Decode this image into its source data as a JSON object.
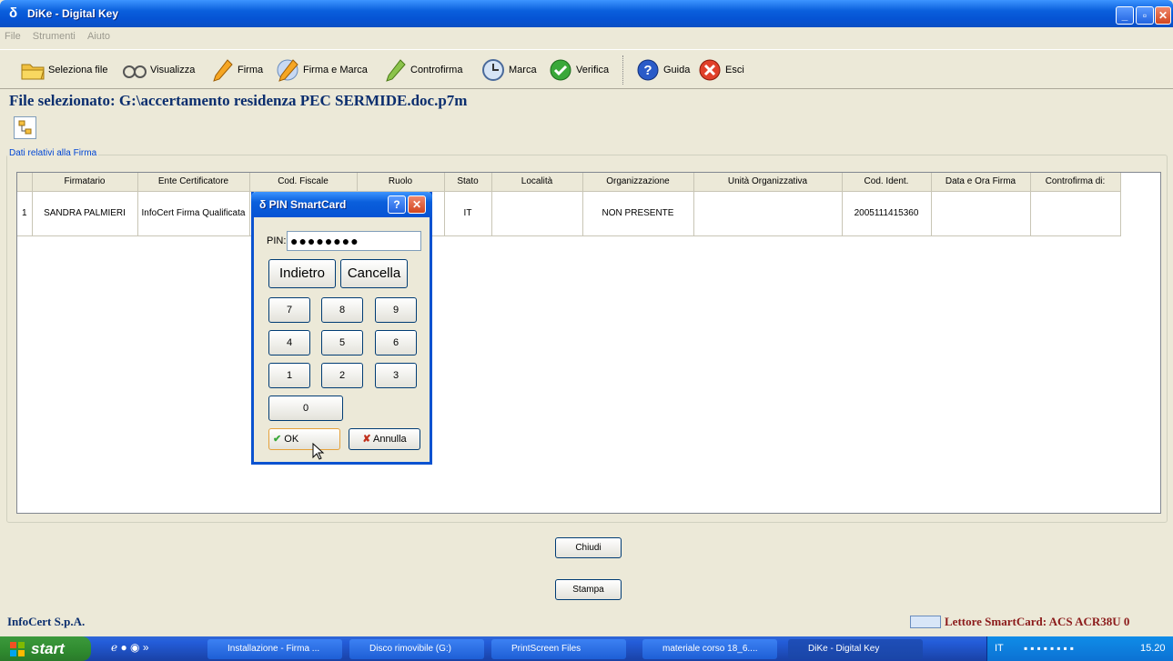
{
  "window": {
    "title": "DiKe - Digital Key",
    "icon": "delta-icon"
  },
  "menu": [
    "File",
    "Strumenti",
    "Aiuto"
  ],
  "toolbar": {
    "items": [
      "Seleziona file",
      "Visualizza",
      "Firma",
      "Firma e Marca",
      "Controfirma",
      "Marca",
      "Verifica",
      "Guida",
      "Esci"
    ]
  },
  "file_selected": "File selezionato: G:\\accertamento residenza PEC SERMIDE.doc.p7m",
  "group_title": "Dati relativi alla Firma",
  "table": {
    "headers": [
      "Firmatario",
      "Ente Certificatore",
      "Cod. Fiscale",
      "Ruolo",
      "Stato",
      "Località",
      "Organizzazione",
      "Unità Organizzativa",
      "Cod. Ident.",
      "Data e Ora Firma",
      "Controfirma di:"
    ],
    "rows": [
      {
        "index": "1",
        "cells": [
          "SANDRA PALMIERI",
          "InfoCert Firma Qualificata",
          "",
          "",
          "IT",
          "",
          "NON PRESENTE",
          "",
          "2005111415360",
          "",
          ""
        ]
      }
    ]
  },
  "buttons": {
    "close": "Chiudi",
    "print": "Stampa"
  },
  "footer": {
    "left": "InfoCert S.p.A.",
    "right": "Lettore SmartCard: ACS ACR38U 0"
  },
  "dialog": {
    "title": "PIN SmartCard",
    "pin_label": "PIN:",
    "pin_value": "●●●●●●●●",
    "back": "Indietro",
    "clear": "Cancella",
    "keys": [
      "7",
      "8",
      "9",
      "4",
      "5",
      "6",
      "1",
      "2",
      "3",
      "0"
    ],
    "ok": "OK",
    "cancel": "Annulla"
  },
  "taskbar": {
    "start": "start",
    "tasks": [
      "Installazione - Firma ...",
      "Disco rimovibile (G:)",
      "PrintScreen Files",
      "materiale corso 18_6....",
      "DiKe - Digital Key"
    ],
    "lang": "IT",
    "clock": "15.20"
  }
}
